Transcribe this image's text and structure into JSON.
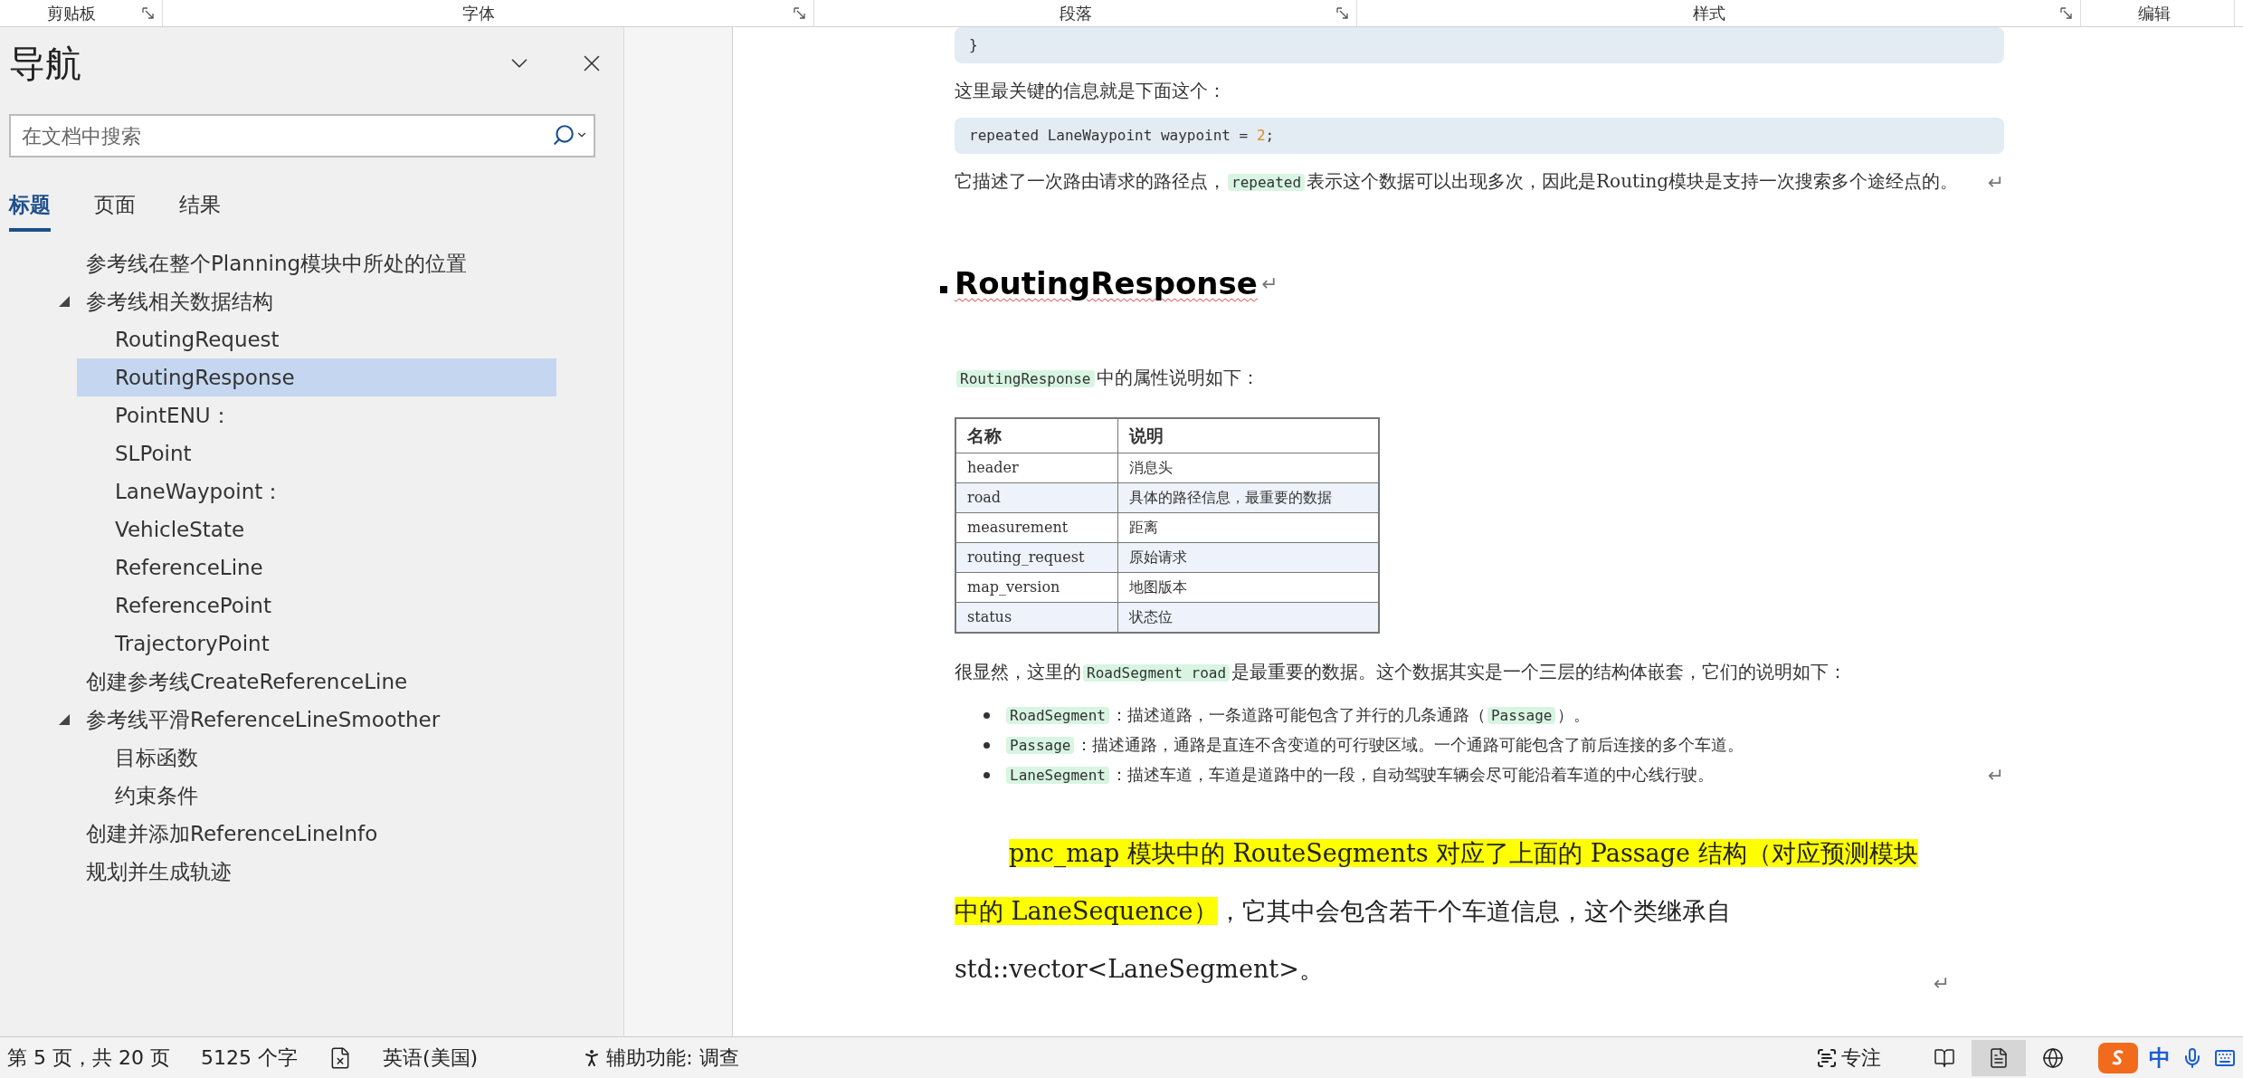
{
  "ribbon_groups": [
    {
      "label": "剪贴板",
      "launcher": true
    },
    {
      "label": "字体",
      "launcher": true
    },
    {
      "label": "段落",
      "launcher": true
    },
    {
      "label": "样式",
      "launcher": true
    },
    {
      "label": "编辑",
      "launcher": false
    }
  ],
  "navigation": {
    "title": "导航",
    "search": {
      "placeholder": "在文档中搜索"
    },
    "tabs": [
      {
        "label": "标题",
        "selected": true
      },
      {
        "label": "页面",
        "selected": false
      },
      {
        "label": "结果",
        "selected": false
      }
    ],
    "headings": [
      {
        "label": "参考线在整个Planning模块中所处的位置",
        "selected": false
      },
      {
        "label": "参考线相关数据结构",
        "selected": false,
        "expanded": true,
        "children": [
          {
            "label": "RoutingRequest",
            "selected": false
          },
          {
            "label": "RoutingResponse",
            "selected": true
          },
          {
            "label": "PointENU：",
            "selected": false
          },
          {
            "label": "SLPoint",
            "selected": false
          },
          {
            "label": "LaneWaypoint：",
            "selected": false
          },
          {
            "label": "VehicleState",
            "selected": false
          },
          {
            "label": "ReferenceLine",
            "selected": false
          },
          {
            "label": "ReferencePoint",
            "selected": false
          },
          {
            "label": "TrajectoryPoint",
            "selected": false
          }
        ]
      },
      {
        "label": "创建参考线CreateReferenceLine",
        "selected": false
      },
      {
        "label": "参考线平滑ReferenceLineSmoother",
        "selected": false,
        "expanded": true,
        "children": [
          {
            "label": "目标函数",
            "selected": false
          },
          {
            "label": "约束条件",
            "selected": false
          }
        ]
      },
      {
        "label": "创建并添加ReferenceLineInfo",
        "selected": false
      },
      {
        "label": "规划并生成轨迹",
        "selected": false
      }
    ]
  },
  "document": {
    "blocks": [
      {
        "kind": "code",
        "segments": [
          {
            "text": "}",
            "kind": "plain"
          }
        ]
      },
      {
        "kind": "paragraph",
        "segments": [
          {
            "text": "这里最关键的信息就是下面这个：",
            "kind": "plain"
          }
        ]
      },
      {
        "kind": "code",
        "segments": [
          {
            "text": "repeated LaneWaypoint waypoint = ",
            "kind": "plain"
          },
          {
            "text": "2",
            "kind": "number"
          },
          {
            "text": ";",
            "kind": "plain"
          }
        ]
      },
      {
        "kind": "paragraph",
        "mark": "↵",
        "segments": [
          {
            "text": "它描述了一次路由请求的路径点，",
            "kind": "plain"
          },
          {
            "text": "repeated",
            "kind": "code"
          },
          {
            "text": "表示这个数据可以出现多次，因此是Routing模块是支持一次搜索多个途经点的。",
            "kind": "plain"
          }
        ]
      },
      {
        "kind": "heading",
        "text": "RoutingResponse",
        "mark": "↵"
      },
      {
        "kind": "paragraph",
        "segments": [
          {
            "text": "RoutingResponse",
            "kind": "code"
          },
          {
            "text": "中的属性说明如下：",
            "kind": "plain"
          }
        ]
      },
      {
        "kind": "table",
        "columns": [
          "名称",
          "说明"
        ],
        "rows": [
          [
            "header",
            "消息头"
          ],
          [
            "road",
            "具体的路径信息，最重要的数据"
          ],
          [
            "measurement",
            "距离"
          ],
          [
            "routing_request",
            "原始请求"
          ],
          [
            "map_version",
            "地图版本"
          ],
          [
            "status",
            "状态位"
          ]
        ]
      },
      {
        "kind": "paragraph",
        "segments": [
          {
            "text": "很显然，这里的",
            "kind": "plain"
          },
          {
            "text": "RoadSegment road",
            "kind": "code"
          },
          {
            "text": "是最重要的数据。这个数据其实是一个三层的结构体嵌套，它们的说明如下：",
            "kind": "plain"
          }
        ]
      },
      {
        "kind": "bullets",
        "mark": "↵",
        "items": [
          [
            {
              "text": "RoadSegment",
              "kind": "code"
            },
            {
              "text": "：描述道路，一条道路可能包含了并行的几条通路（",
              "kind": "plain"
            },
            {
              "text": "Passage",
              "kind": "code"
            },
            {
              "text": "）。",
              "kind": "plain"
            }
          ],
          [
            {
              "text": "Passage",
              "kind": "code"
            },
            {
              "text": "：描述通路，通路是直连不含变道的可行驶区域。一个通路可能包含了前后连接的多个车道。",
              "kind": "plain"
            }
          ],
          [
            {
              "text": "LaneSegment",
              "kind": "code"
            },
            {
              "text": "：描述车道，车道是道路中的一段，自动驾驶车辆会尽可能沿着车道的中心线行驶。",
              "kind": "plain"
            }
          ]
        ]
      },
      {
        "kind": "highlight",
        "mark": "↵",
        "segments": [
          {
            "text": "pnc_map",
            "kind": "highlight"
          },
          {
            "text": " 模块中的 RouteSegments 对应了上面的 Passage 结构（对应预测模块中的 LaneSequence）",
            "kind": "highlight"
          },
          {
            "text": "，它其中会包含若干个车道信息，这个类继承自 std::vector<LaneSegment>。",
            "kind": "plain"
          }
        ]
      }
    ]
  },
  "status_bar": {
    "left": [
      {
        "kind": "text",
        "text": "第 5 页，共 20 页"
      },
      {
        "kind": "text",
        "text": "5125 个字"
      },
      {
        "kind": "proofing"
      },
      {
        "kind": "text",
        "text": "英语(美国)"
      },
      {
        "kind": "accessibility",
        "text": "辅助功能: 调查"
      }
    ],
    "focus": "专注",
    "views": [
      {
        "kind": "read",
        "selected": false
      },
      {
        "kind": "print",
        "selected": true
      },
      {
        "kind": "web",
        "selected": false
      }
    ],
    "ime": "中"
  }
}
